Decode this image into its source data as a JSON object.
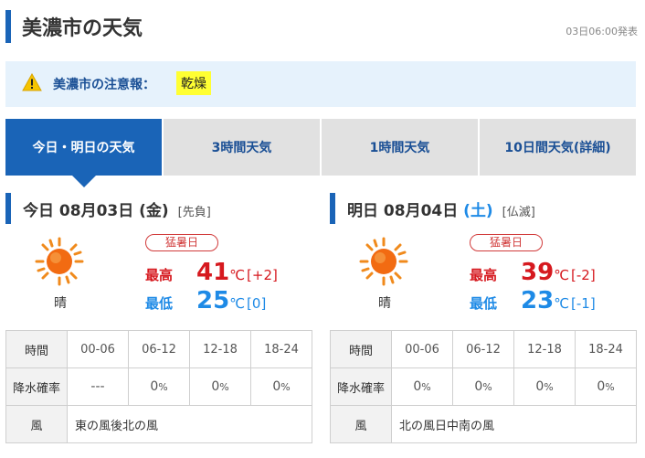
{
  "header": {
    "title": "美濃市の天気",
    "published": "03日06:00発表"
  },
  "warning": {
    "label": "美濃市の注意報：",
    "value": "乾燥"
  },
  "tabs": [
    {
      "label": "今日・明日の天気",
      "active": true
    },
    {
      "label": "3時間天気",
      "active": false
    },
    {
      "label": "1時間天気",
      "active": false
    },
    {
      "label": "10日間天気(詳細)",
      "active": false
    }
  ],
  "colors": {
    "accent": "#1a64b7",
    "high": "#d6191f",
    "low": "#1e8ae6",
    "warning_bg": "#ffff33"
  },
  "today": {
    "heading_prefix": "今日 08月03日",
    "weekday": "(金)",
    "rokuyo": "[先負]",
    "icon": "sunny-icon",
    "weather": "晴",
    "badge": "猛暑日",
    "high_label": "最高",
    "high_value": "41",
    "high_unit": "℃",
    "high_diff": "[+2]",
    "low_label": "最低",
    "low_value": "25",
    "low_unit": "℃",
    "low_diff": "[0]",
    "table": {
      "time_label": "時間",
      "periods": [
        "00-06",
        "06-12",
        "12-18",
        "18-24"
      ],
      "rain_label": "降水確率",
      "rain": [
        "---",
        "0",
        "0",
        "0"
      ],
      "rain_unit": "%",
      "wind_label": "風",
      "wind": "東の風後北の風"
    }
  },
  "tomorrow": {
    "heading_prefix": "明日 08月04日",
    "weekday": "(土)",
    "rokuyo": "[仏滅]",
    "icon": "sunny-icon",
    "weather": "晴",
    "badge": "猛暑日",
    "high_label": "最高",
    "high_value": "39",
    "high_unit": "℃",
    "high_diff": "[-2]",
    "low_label": "最低",
    "low_value": "23",
    "low_unit": "℃",
    "low_diff": "[-1]",
    "table": {
      "time_label": "時間",
      "periods": [
        "00-06",
        "06-12",
        "12-18",
        "18-24"
      ],
      "rain_label": "降水確率",
      "rain": [
        "0",
        "0",
        "0",
        "0"
      ],
      "rain_unit": "%",
      "wind_label": "風",
      "wind": "北の風日中南の風"
    }
  }
}
